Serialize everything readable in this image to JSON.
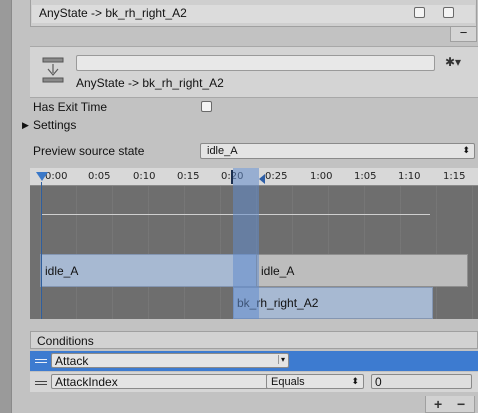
{
  "transition_list": {
    "item_label": "AnyState -> bk_rh_right_A2",
    "remove_label": "−"
  },
  "header": {
    "title": "AnyState -> bk_rh_right_A2",
    "name_value": "",
    "icon": "transition-icon",
    "gear_icon": "gear-icon"
  },
  "settings": {
    "has_exit_time_label": "Has Exit Time",
    "has_exit_time_checked": false,
    "settings_label": "Settings",
    "preview_label": "Preview source state",
    "preview_value": "idle_A"
  },
  "timeline": {
    "ticks": [
      "0:00",
      "0:05",
      "0:10",
      "0:15",
      "0:20",
      "0:25",
      "1:00",
      "1:05",
      "1:10",
      "1:15"
    ],
    "source_clip": "idle_A",
    "source_clip_repeat": "idle_A",
    "destination_clip": "bk_rh_right_A2"
  },
  "conditions": {
    "header": "Conditions",
    "rows": [
      {
        "parameter": "Attack",
        "selected": true
      },
      {
        "parameter": "AttackIndex",
        "mode": "Equals",
        "value": "0",
        "selected": false
      }
    ],
    "add_label": "+",
    "remove_label": "−"
  }
}
